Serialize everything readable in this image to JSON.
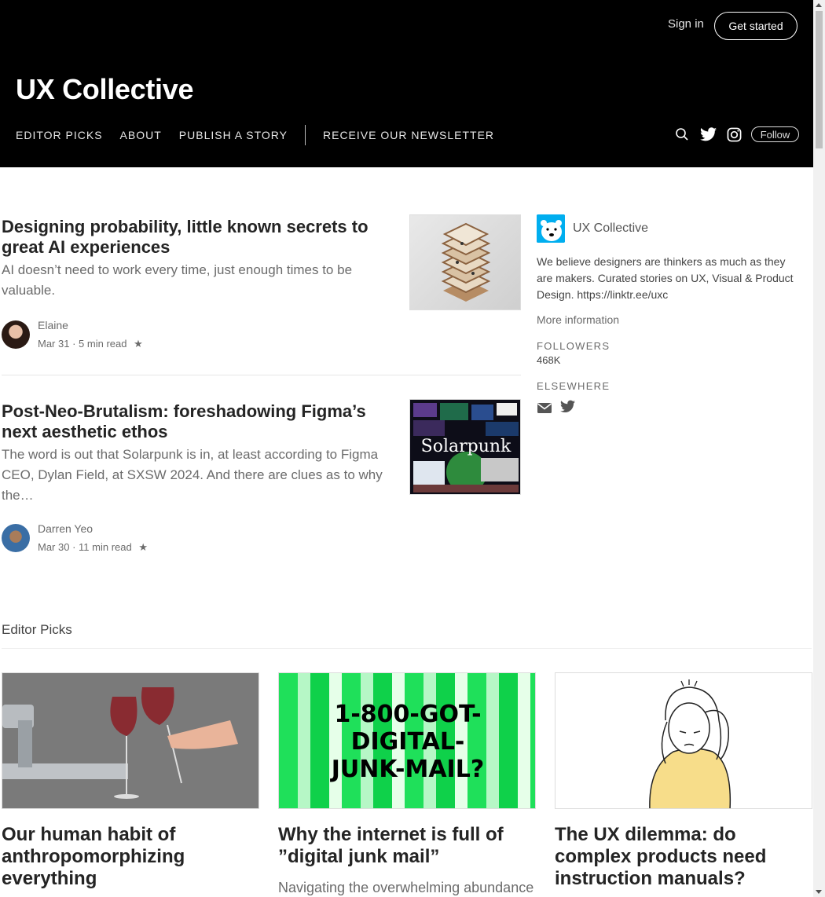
{
  "header": {
    "brand": "UX Collective",
    "signin": "Sign in",
    "get_started": "Get started",
    "nav": [
      "EDITOR PICKS",
      "ABOUT",
      "PUBLISH A STORY",
      "RECEIVE OUR NEWSLETTER"
    ],
    "follow": "Follow"
  },
  "articles": [
    {
      "title": "Designing probability, little known secrets to great AI experiences",
      "desc": "AI doesn’t need to work every time, just enough times to be valuable.",
      "author": "Elaine",
      "date": "Mar 31",
      "read": "5 min read",
      "star": "★"
    },
    {
      "title": "Post-Neo-Brutalism: foreshadowing Figma’s next aesthetic ethos",
      "desc": "The word is out that Solarpunk is in, at least according to Figma CEO, Dylan Field, at SXSW 2024. And there are clues as to why the…",
      "author": "Darren Yeo",
      "date": "Mar 30",
      "read": "11 min read",
      "star": "★",
      "thumb_text": "Solarpunk"
    }
  ],
  "sidebar": {
    "name": "UX Collective",
    "about": "We believe designers are thinkers as much as they are makers. Curated stories on UX, Visual & Product Design. https://linktr.ee/uxc",
    "more_info": "More information",
    "followers_label": "FOLLOWERS",
    "followers_value": "468K",
    "elsewhere_label": "ELSEWHERE"
  },
  "editor_picks": {
    "title": "Editor Picks",
    "cards": [
      {
        "title": "Our human habit of anthropomorphizing everything",
        "desc": ""
      },
      {
        "title": "Why the internet is full of ”digital junk mail”",
        "desc": "Navigating the overwhelming abundance",
        "img_text": [
          "1-800-GOT-",
          "DIGITAL-",
          "JUNK-MAIL?"
        ]
      },
      {
        "title": "The UX dilemma: do complex products need instruction manuals?",
        "desc": ""
      }
    ]
  },
  "colors": {
    "header_bg": "#000000",
    "junk_green": "#22e05a",
    "brand_blue": "#00aeef"
  }
}
